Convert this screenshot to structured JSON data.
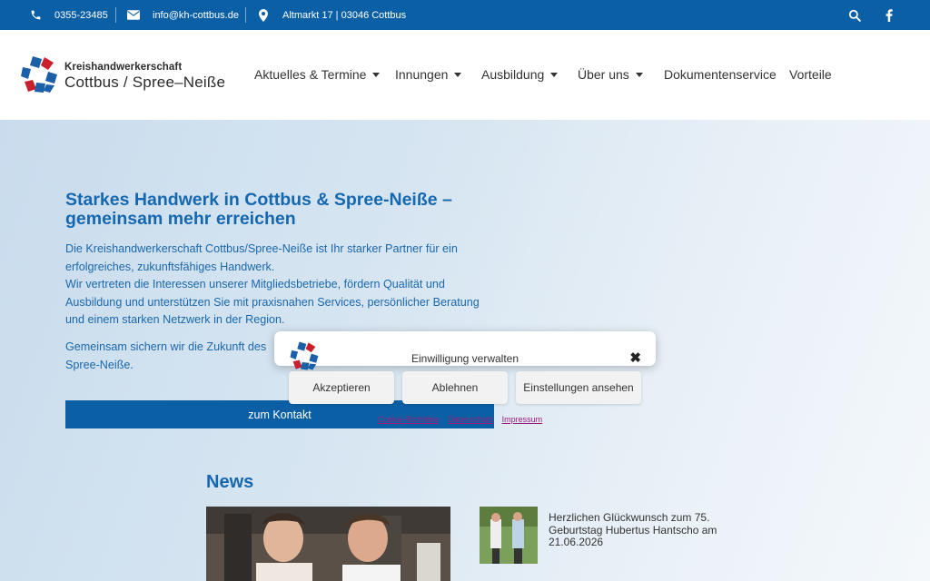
{
  "topbar": {
    "phone": "0355-23485",
    "email": "info@kh-cottbus.de",
    "address": "Altmarkt 17 | 03046 Cottbus"
  },
  "logo": {
    "line1": "Kreishandwerkerschaft",
    "line2": "Cottbus / Spree–Neiße"
  },
  "nav": {
    "items": [
      {
        "label": "Aktuelles & Termine"
      },
      {
        "label": "Innungen"
      },
      {
        "label": "Ausbildung"
      },
      {
        "label": "Über uns"
      },
      {
        "label": "Dokumentenservice"
      },
      {
        "label": "Vorteile"
      }
    ]
  },
  "hero": {
    "title": "Starkes Handwerk in Cottbus & Spree-Neiße – gemeinsam mehr erreichen",
    "paragraph1": "Die Kreishandwerkerschaft Cottbus/Spree-Neiße ist Ihr starker Partner für ein erfolgreiches, zukunftsfähiges Handwerk.",
    "paragraph1b": "Wir vertreten die Interessen unserer Mitgliedsbetriebe, fördern Qualität und Ausbildung und unterstützen Sie mit praxisnahen Services, persönlicher Beratung und einem starken Netzwerk in der Region.",
    "paragraph2": "Gemeinsam sichern wir die Zukunft des",
    "paragraph2b": "Spree-Neiße.",
    "cta_label": "zum Kontakt"
  },
  "news": {
    "heading": "News",
    "item1_text": "Herzlichen Glückwunsch zum 75. Geburtstag Hubertus Hantscho am 21.06.2026"
  },
  "consent": {
    "title": "Einwilligung verwalten",
    "accept_label": "Akzeptieren",
    "decline_label": "Ablehnen",
    "settings_label": "Einstellungen ansehen",
    "link1": "Cookie-Richtlinie",
    "link2": "Datenschutz",
    "link3": "Impressum"
  },
  "colors": {
    "brand_blue": "#0b5fa5",
    "heading_blue": "#1568b0",
    "link_purple": "#9b1d7a"
  }
}
